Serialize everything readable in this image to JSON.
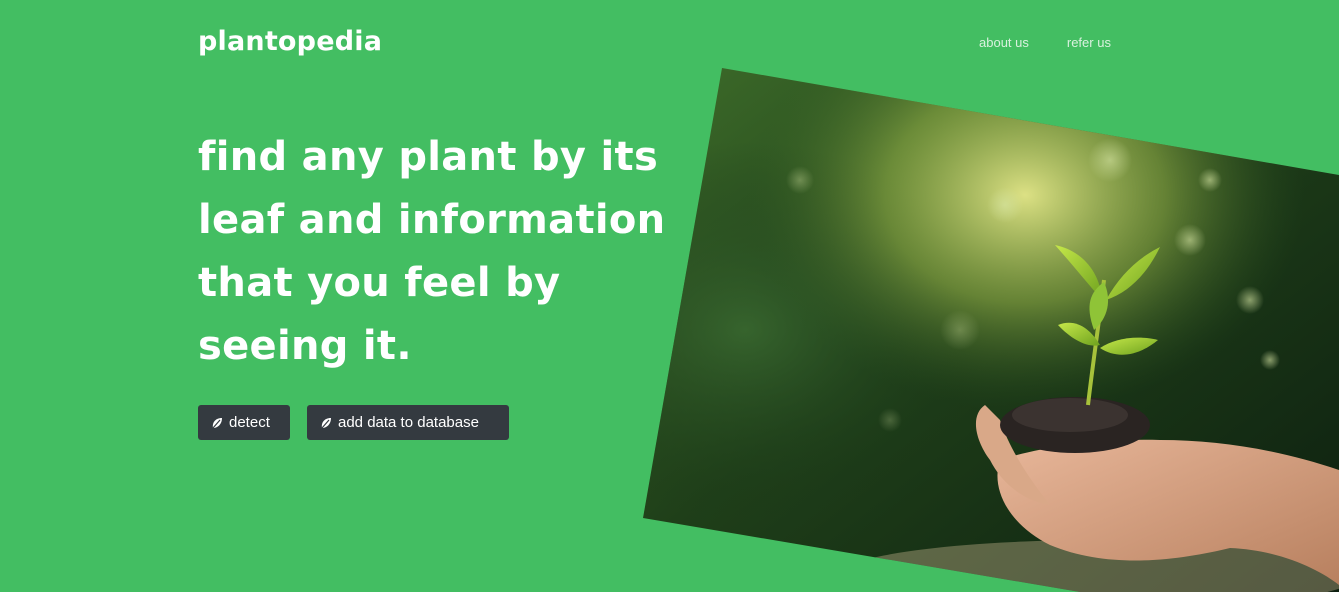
{
  "brand": {
    "name": "plantopedia"
  },
  "nav": {
    "items": [
      {
        "label": "about us"
      },
      {
        "label": "refer us"
      }
    ]
  },
  "hero": {
    "headline": "find any plant by its leaf and information that you feel by seeing it.",
    "buttons": [
      {
        "label": "detect",
        "icon": "leaf-icon"
      },
      {
        "label": "add data to database",
        "icon": "leaf-icon"
      }
    ],
    "image": {
      "subject": "seedling in cupped hands"
    }
  },
  "colors": {
    "background": "#43be62",
    "button": "#343a40",
    "text": "#ffffff"
  }
}
